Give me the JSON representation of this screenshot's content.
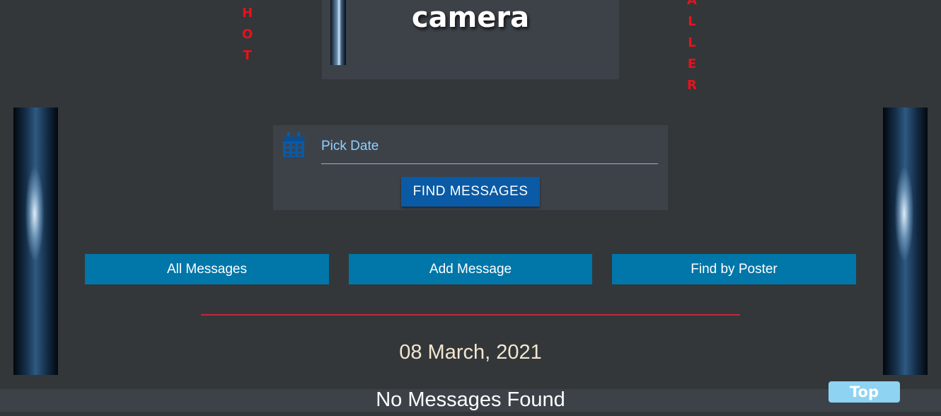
{
  "decor": {
    "left_letters": [
      "H",
      "O",
      "T"
    ],
    "right_letters": [
      "A",
      "L",
      "L",
      "E",
      "R"
    ],
    "letter_color": "#e8121c"
  },
  "header": {
    "title": "camera"
  },
  "date_picker": {
    "label": "Pick Date",
    "find_button": "FIND MESSAGES",
    "icon": "calendar-icon"
  },
  "nav": {
    "buttons": [
      {
        "label": "All Messages"
      },
      {
        "label": "Add Message"
      },
      {
        "label": "Find by Poster"
      }
    ],
    "color": "#0076a9"
  },
  "main": {
    "selected_date": "08 March, 2021",
    "status": "No Messages Found"
  },
  "top_button": {
    "label": "Top"
  },
  "colors": {
    "background": "#33373a",
    "panel": "#3d4249",
    "accent_blue": "#0a5aa6",
    "rule_red": "#c0283a",
    "date_text": "#f3e6cf"
  }
}
